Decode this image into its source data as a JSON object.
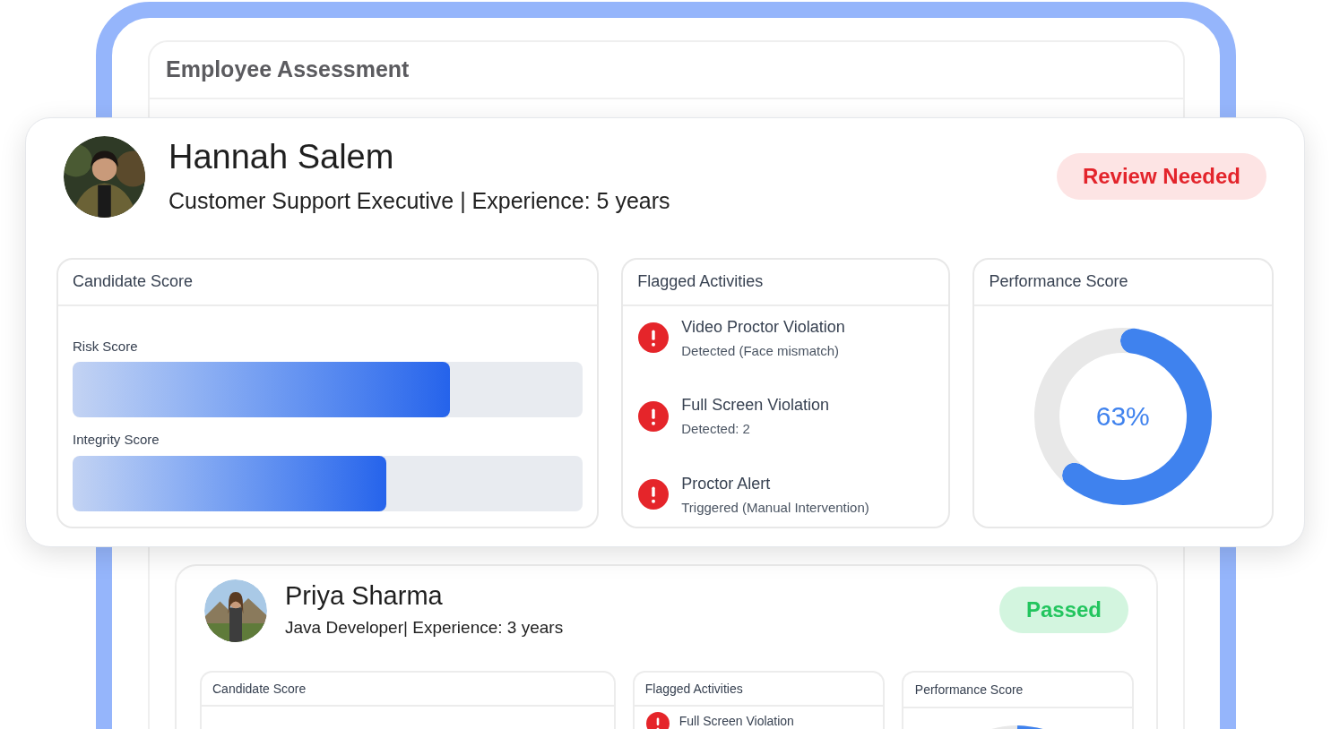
{
  "header": {
    "title": "Employee Assessment"
  },
  "candidates": [
    {
      "kind": "featured",
      "name": "Hannah Salem",
      "subtitle": "Customer Support Executive | Experience: 5 years",
      "status": {
        "label": "Review Needed",
        "kind": "review"
      },
      "candidate_score": {
        "title": "Candidate Score",
        "scores": [
          {
            "label": "Risk Score",
            "level": 0.74
          },
          {
            "label": "Integrity Score",
            "level": 0.615
          }
        ]
      },
      "flagged": {
        "title": "Flagged Activities",
        "items": [
          {
            "title": "Video Proctor Violation",
            "detail": "Detected (Face mismatch)"
          },
          {
            "title": "Full Screen Violation",
            "detail": "Detected: 2"
          },
          {
            "title": "Proctor Alert",
            "detail": "Triggered (Manual Intervention)"
          }
        ]
      },
      "performance": {
        "title": "Performance Score",
        "value": "63%",
        "chart_data": {
          "type": "donut",
          "values": [
            63,
            37
          ]
        }
      }
    },
    {
      "kind": "compact",
      "name": "Priya Sharma",
      "subtitle": "Java Developer| Experience: 3 years",
      "status": {
        "label": "Passed",
        "kind": "passed"
      },
      "candidate_score": {
        "title": "Candidate Score"
      },
      "flagged": {
        "title": "Flagged Activities",
        "items": [
          {
            "title": "Full Screen Violation"
          }
        ]
      },
      "performance": {
        "title": "Performance Score"
      }
    }
  ]
}
